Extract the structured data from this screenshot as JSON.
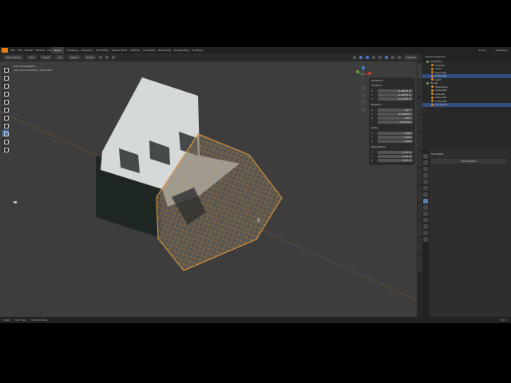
{
  "app": {
    "menu": [
      "File",
      "Edit",
      "Render",
      "Window",
      "Help"
    ],
    "workspaces": [
      "Layout",
      "Modeling",
      "Sculpting",
      "UV Editing",
      "Texture Paint",
      "Shading",
      "Animation",
      "Rendering",
      "Compositing",
      "Scripting"
    ],
    "active_workspace": "Layout",
    "scene": "Scene",
    "view_layer": "ViewLayer"
  },
  "header": {
    "mode": "Object Mode",
    "view": "View",
    "select": "Select",
    "add": "Add",
    "object": "Object",
    "orientation": "Global",
    "options": "Options"
  },
  "viewport": {
    "view_name": "User Orthographic",
    "collection_info": "(1) Scene Collection | Circle.003"
  },
  "npanel": {
    "section": "Transform",
    "location_label": "Location:",
    "location": {
      "x": "-0.10676 m",
      "y": "0.10675 m",
      "z": "0.11379 m"
    },
    "rotation_label": "Rotation:",
    "rotation": {
      "x": "0.17°",
      "y": "0.000035°",
      "z": "0.54°"
    },
    "mode_label": "XYZ Euler",
    "scale_label": "Scale:",
    "scale": {
      "x": "1.000",
      "y": "1.000",
      "z": "1.000"
    },
    "dimensions_label": "Dimensions:",
    "dimensions": {
      "x": "0.73 m",
      "y": "0.83 m",
      "z": "0.07 m"
    }
  },
  "outliner": {
    "title": "Scene Collection",
    "rows": [
      {
        "label": "Collection",
        "type": "collection",
        "selected": false
      },
      {
        "label": "Camera",
        "type": "object",
        "selected": false
      },
      {
        "label": "Cube",
        "type": "object",
        "selected": false
      },
      {
        "label": "Cube.001",
        "type": "object",
        "selected": false
      },
      {
        "label": "Cube.002",
        "type": "object",
        "selected": true
      },
      {
        "label": "Light",
        "type": "object",
        "selected": false
      },
      {
        "label": "House",
        "type": "collection",
        "selected": false
      },
      {
        "label": "Wireframe",
        "type": "object",
        "selected": false
      },
      {
        "label": "Cube.003",
        "type": "object",
        "selected": false
      },
      {
        "label": "Cylinder",
        "type": "object",
        "selected": false
      },
      {
        "label": "Cube.004",
        "type": "object",
        "selected": false
      },
      {
        "label": "Cube.005",
        "type": "object",
        "selected": false
      },
      {
        "label": "Circle.003",
        "type": "object",
        "selected": true
      }
    ]
  },
  "properties": {
    "object_name": "Circle.003",
    "add_modifier": "Add Modifier"
  },
  "status": {
    "items": [
      "Select",
      "Pan View",
      "Context Menu"
    ],
    "version": "3.6.2"
  },
  "colors": {
    "accent": "#4772b3",
    "selection_outline": "#e08a2e",
    "background": "#3d3d3d"
  }
}
